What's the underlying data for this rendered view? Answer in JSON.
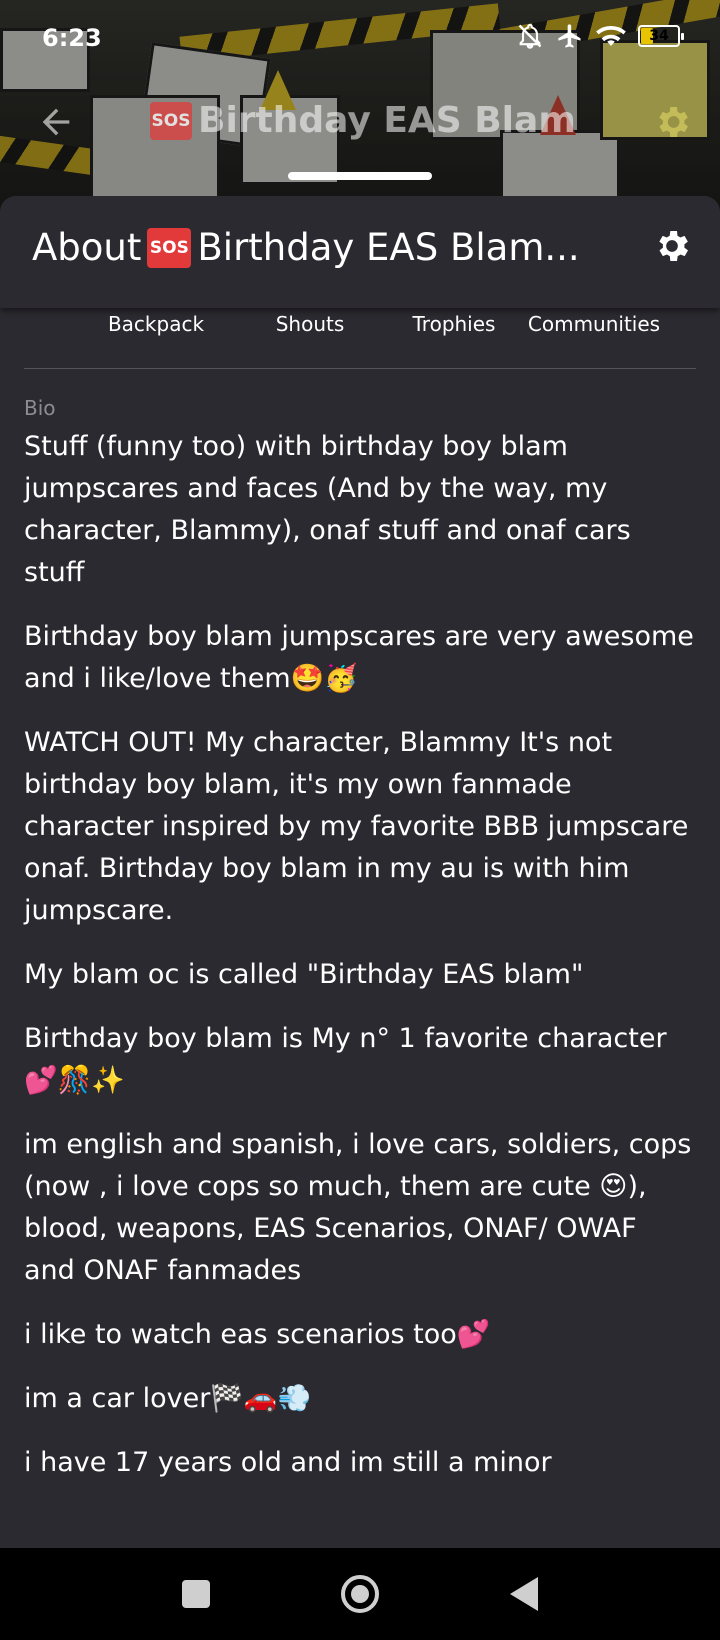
{
  "status_bar": {
    "time": "6:23",
    "battery": "34",
    "battery_level_percent": 34,
    "icons": [
      "bell-muted-icon",
      "airplane-icon",
      "wifi-icon",
      "battery-icon"
    ]
  },
  "header": {
    "sos_badge": "SOS",
    "title": "Birthday EAS Blam",
    "icons": [
      "back-arrow-icon",
      "gear-icon"
    ]
  },
  "sheet": {
    "title_prefix": "About",
    "sos_badge": "SOS",
    "title_rest": "Birthday EAS Blam...",
    "settings_icon": "gear-icon"
  },
  "tabs": [
    {
      "label": "Backpack"
    },
    {
      "label": "Shouts"
    },
    {
      "label": "Trophies"
    },
    {
      "label": "Communities"
    }
  ],
  "bio": {
    "label": "Bio",
    "paragraphs": [
      "Stuff (funny too) with birthday boy blam jumpscares and faces (And by the way, my character, Blammy), onaf stuff and onaf cars stuff",
      "Birthday boy blam jumpscares are very awesome and i like/love them🤩🥳",
      "WATCH OUT! My character, Blammy It's not birthday boy blam, it's my own fanmade character inspired by my favorite BBB jumpscare onaf. Birthday boy blam in my au is with him jumpscare.",
      "My blam oc is called \"Birthday EAS blam\"",
      "Birthday boy blam is My n° 1 favorite character 💕🎊✨",
      "im english and spanish, i love cars, soldiers, cops (now , i love cops so much, them are cute 😍), blood, weapons, EAS Scenarios, ONAF/ OWAF and ONAF fanmades",
      "i like to watch eas scenarios too💕",
      "im a car lover🏁🚗💨",
      "i have 17 years old and im still a minor"
    ]
  },
  "colors": {
    "sheet_bg": "#2b2a30",
    "sos_red": "#e23a3a",
    "battery_yellow": "#e7c300",
    "muted_label": "#8d8c92"
  },
  "navbar": {
    "icons": [
      "recents-square-icon",
      "home-circle-icon",
      "back-triangle-icon"
    ]
  }
}
